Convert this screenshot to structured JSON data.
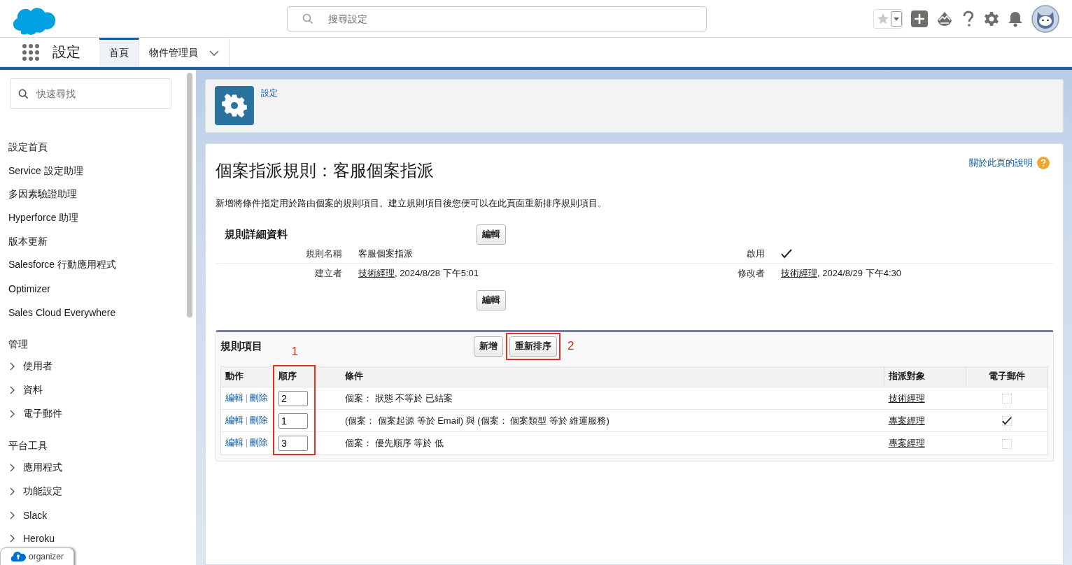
{
  "header": {
    "search": {
      "placeholder": "搜尋設定"
    }
  },
  "nav": {
    "app_name": "設定",
    "tabs": [
      {
        "label": "首頁",
        "selected": true,
        "dropdown": false
      },
      {
        "label": "物件管理員",
        "selected": false,
        "dropdown": true
      }
    ]
  },
  "sidebar": {
    "search": {
      "placeholder": "快速尋找"
    },
    "items": [
      {
        "label": "設定首頁"
      },
      {
        "label": "Service 設定助理"
      },
      {
        "label": "多因素驗證助理"
      },
      {
        "label": "Hyperforce 助理"
      },
      {
        "label": "版本更新"
      },
      {
        "label": "Salesforce 行動應用程式"
      },
      {
        "label": "Optimizer"
      },
      {
        "label": "Sales Cloud Everywhere"
      }
    ],
    "sections": [
      {
        "title": "管理",
        "items": [
          {
            "label": "使用者",
            "expanded": false
          },
          {
            "label": "資料",
            "expanded": false
          },
          {
            "label": "電子郵件",
            "expanded": false
          }
        ]
      },
      {
        "title": "平台工具",
        "items": [
          {
            "label": "應用程式",
            "expanded": false
          },
          {
            "label": "功能設定",
            "expanded": false
          },
          {
            "label": "Slack",
            "expanded": false
          },
          {
            "label": "Heroku",
            "expanded": false
          }
        ]
      }
    ]
  },
  "organizer": {
    "label": "organizer"
  },
  "breadcrumb": {
    "label": "設定"
  },
  "page": {
    "title": "個案指派規則：客服個案指派",
    "help_link": "關於此頁的說明",
    "description": "新增將條件指定用於路由個案的規則項目。建立規則項目後您便可以在此頁面重新排序規則項目。"
  },
  "detail": {
    "heading": "規則詳細資料",
    "edit_top": "編輯",
    "edit_bottom": "編輯",
    "rows": [
      [
        {
          "label": "規則名稱",
          "kind": "text",
          "value": "客服個案指派"
        },
        {
          "label": "啟用",
          "kind": "check",
          "checked": true
        }
      ],
      [
        {
          "label": "建立者",
          "kind": "user",
          "link": "技術經理",
          "value": ", 2024/8/28 下午5:01"
        },
        {
          "label": "修改者",
          "kind": "user",
          "link": "技術經理",
          "value": ", 2024/8/29 下午4:30"
        }
      ]
    ]
  },
  "rule_entries": {
    "heading": "規則項目",
    "new_button": "新增",
    "reorder_button": "重新排序",
    "columns": [
      "動作",
      "順序",
      "條件",
      "指派對象",
      "電子郵件"
    ],
    "rows": [
      {
        "actions": [
          "編輯",
          "刪除"
        ],
        "order": "2",
        "criteria": "個案： 狀態 不等於 已結案",
        "assigned_to": "技術經理",
        "email": false
      },
      {
        "actions": [
          "編輯",
          "刪除"
        ],
        "order": "1",
        "criteria": "(個案： 個案起源 等於 Email) 與 (個案： 個案類型 等於 維運服務)",
        "assigned_to": "專案經理",
        "email": true
      },
      {
        "actions": [
          "編輯",
          "刪除"
        ],
        "order": "3",
        "criteria": "個案： 優先順序 等於 低",
        "assigned_to": "專案經理",
        "email": false
      }
    ]
  },
  "annotations": {
    "order_column": "1",
    "reorder_button": "2"
  }
}
